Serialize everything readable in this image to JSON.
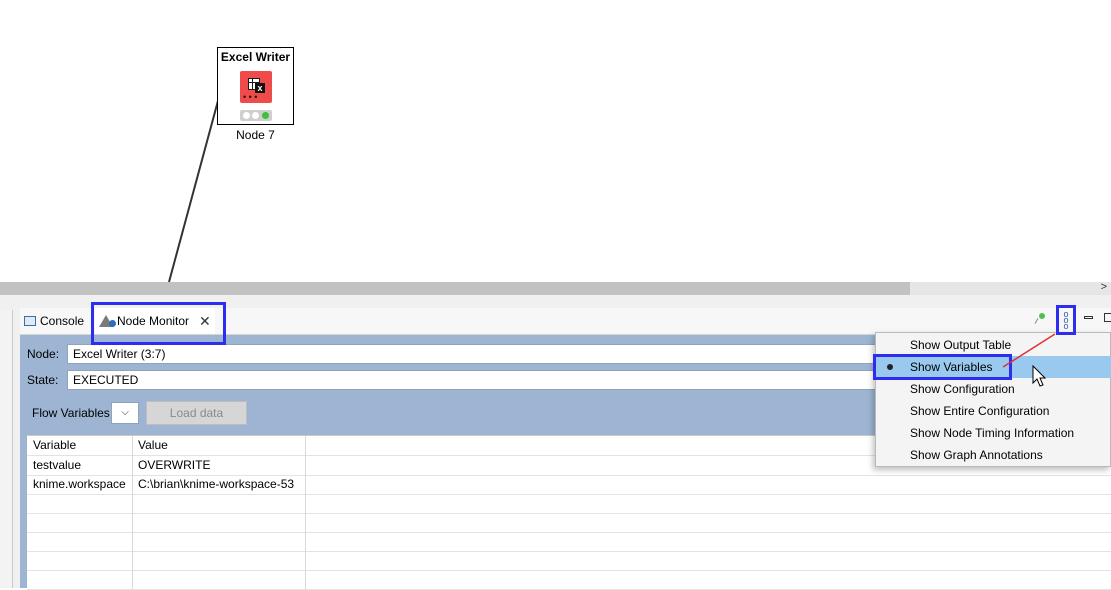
{
  "canvas": {
    "node": {
      "title": "Excel Writer",
      "label": "Node 7",
      "icon": "excel-writer-icon",
      "status": "executed"
    }
  },
  "panel": {
    "tabs": [
      {
        "label": "Console",
        "icon": "console-icon"
      },
      {
        "label": "Node Monitor",
        "icon": "node-monitor-icon",
        "close": "✕"
      }
    ],
    "node_label": "Node:",
    "node_value": "Excel Writer  (3:7)",
    "state_label": "State:",
    "state_value": "EXECUTED",
    "flow_label": "Flow Variables",
    "flow_select_value": "",
    "load_button": "Load data",
    "table": {
      "headers": [
        "Variable",
        "Value"
      ],
      "rows": [
        [
          "testvalue",
          "OVERWRITE"
        ],
        [
          "knime.workspace",
          "C:\\brian\\knime-workspace-53"
        ]
      ]
    }
  },
  "menu": {
    "items": [
      {
        "label": "Show Output Table",
        "selected": false
      },
      {
        "label": "Show Variables",
        "selected": true
      },
      {
        "label": "Show Configuration",
        "selected": false
      },
      {
        "label": "Show Entire Configuration",
        "selected": false
      },
      {
        "label": "Show Node Timing Information",
        "selected": false
      },
      {
        "label": "Show Graph Annotations",
        "selected": false
      }
    ]
  },
  "colors": {
    "highlight": "#2d2df0",
    "arrow": "#e03030",
    "content_bg": "#9db5d3",
    "menu_selected": "#99c9ef",
    "node_icon": "#f04b4b"
  }
}
